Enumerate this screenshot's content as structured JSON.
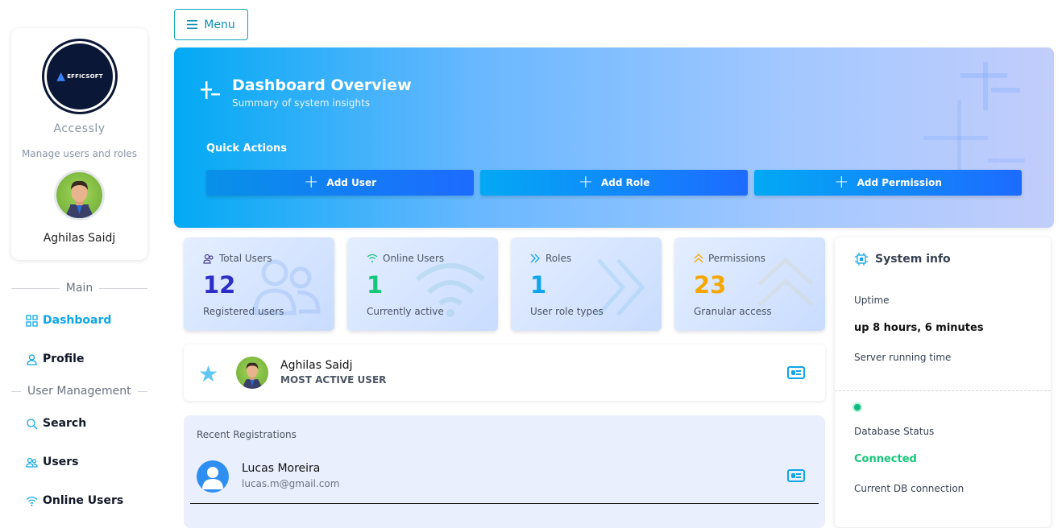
{
  "sidebar": {
    "logo_text": "EFFICSOFT",
    "app_name": "Accessly",
    "app_desc": "Manage users and roles",
    "user_name": "Aghilas Saidj",
    "section_main": "Main",
    "section_user_mgmt": "User Management",
    "items": [
      {
        "label": "Dashboard",
        "icon": "grid-icon"
      },
      {
        "label": "Profile",
        "icon": "user-icon"
      },
      {
        "label": "Search",
        "icon": "search-icon"
      },
      {
        "label": "Users",
        "icon": "users-icon"
      },
      {
        "label": "Online Users",
        "icon": "wifi-icon"
      }
    ]
  },
  "header": {
    "menu_label": "Menu"
  },
  "hero": {
    "title": "Dashboard Overview",
    "subtitle": "Summary of system insights",
    "quick_actions_title": "Quick Actions",
    "actions": [
      {
        "label": "Add User"
      },
      {
        "label": "Add Role"
      },
      {
        "label": "Add Permission"
      }
    ]
  },
  "stats": [
    {
      "label": "Total Users",
      "value": "12",
      "desc": "Registered users",
      "color": "#2c2ec6",
      "icon": "users-icon"
    },
    {
      "label": "Online Users",
      "value": "1",
      "desc": "Currently active",
      "color": "#16c77a",
      "icon": "wifi-icon"
    },
    {
      "label": "Roles",
      "value": "1",
      "desc": "User role types",
      "color": "#0ea5e9",
      "icon": "chevrons-right-icon"
    },
    {
      "label": "Permissions",
      "value": "23",
      "desc": "Granular access",
      "color": "#f5a700",
      "icon": "chevrons-up-icon"
    }
  ],
  "most_active": {
    "name": "Aghilas Saidj",
    "role": "MOST ACTIVE USER"
  },
  "recent": {
    "title": "Recent Registrations",
    "items": [
      {
        "name": "Lucas Moreira",
        "email": "lucas.m@gmail.com"
      }
    ]
  },
  "system_info": {
    "title": "System info",
    "uptime_label": "Uptime",
    "uptime_value": "up 8 hours, 6 minutes",
    "uptime_desc": "Server running time",
    "db_label": "Database Status",
    "db_value": "Connected",
    "db_desc": "Current DB connection",
    "db_color": "#16c77a"
  },
  "colors": {
    "accent": "#0ea5e9",
    "button_start": "#0891e8",
    "button_end": "#1d6bff"
  }
}
